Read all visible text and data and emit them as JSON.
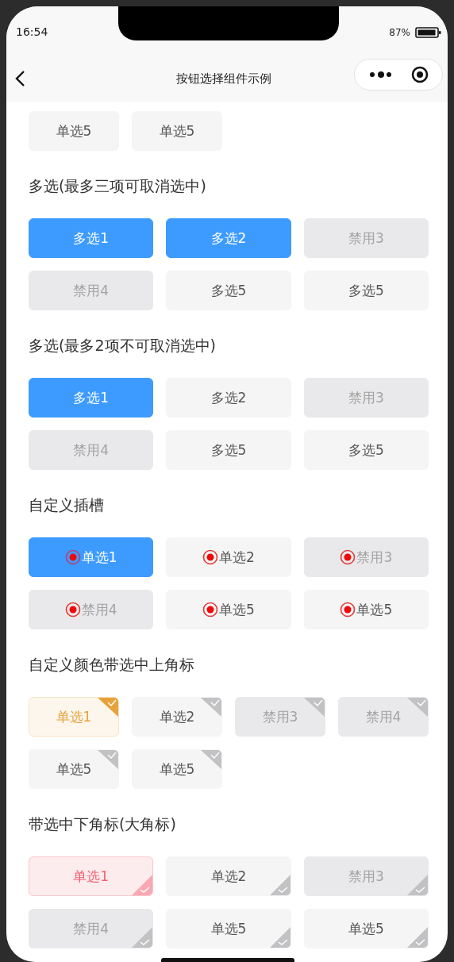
{
  "status_bar": {
    "time": "16:54",
    "battery": "87%"
  },
  "nav_bar": {
    "title": "按钮选择组件示例"
  },
  "sections": [
    {
      "kind": "compact",
      "options": [
        {
          "label": "单选5",
          "selected": false,
          "disabled": false
        },
        {
          "label": "单选5",
          "selected": false,
          "disabled": false
        }
      ]
    },
    {
      "kind": "plain",
      "title": "多选(最多三项可取消选中)",
      "options": [
        {
          "label": "多选1",
          "selected": true,
          "disabled": false
        },
        {
          "label": "多选2",
          "selected": true,
          "disabled": false
        },
        {
          "label": "禁用3",
          "selected": false,
          "disabled": true
        },
        {
          "label": "禁用4",
          "selected": false,
          "disabled": true
        },
        {
          "label": "多选5",
          "selected": false,
          "disabled": false
        },
        {
          "label": "多选5",
          "selected": false,
          "disabled": false
        }
      ]
    },
    {
      "kind": "plain",
      "title": "多选(最多2项不可取消选中)",
      "options": [
        {
          "label": "多选1",
          "selected": true,
          "disabled": false
        },
        {
          "label": "多选2",
          "selected": false,
          "disabled": false
        },
        {
          "label": "禁用3",
          "selected": false,
          "disabled": true
        },
        {
          "label": "禁用4",
          "selected": false,
          "disabled": true
        },
        {
          "label": "多选5",
          "selected": false,
          "disabled": false
        },
        {
          "label": "多选5",
          "selected": false,
          "disabled": false
        }
      ]
    },
    {
      "kind": "slot",
      "title": "自定义插槽",
      "options": [
        {
          "label": "单选1",
          "selected": true,
          "disabled": false
        },
        {
          "label": "单选2",
          "selected": false,
          "disabled": false
        },
        {
          "label": "禁用3",
          "selected": false,
          "disabled": true
        },
        {
          "label": "禁用4",
          "selected": false,
          "disabled": true
        },
        {
          "label": "单选5",
          "selected": false,
          "disabled": false
        },
        {
          "label": "单选5",
          "selected": false,
          "disabled": false
        }
      ]
    },
    {
      "kind": "corner-top",
      "title": "自定义颜色带选中上角标",
      "options": [
        {
          "label": "单选1",
          "selected": true,
          "disabled": false
        },
        {
          "label": "单选2",
          "selected": false,
          "disabled": false
        },
        {
          "label": "禁用3",
          "selected": false,
          "disabled": true
        },
        {
          "label": "禁用4",
          "selected": false,
          "disabled": true
        },
        {
          "label": "单选5",
          "selected": false,
          "disabled": false
        },
        {
          "label": "单选5",
          "selected": false,
          "disabled": false
        }
      ]
    },
    {
      "kind": "corner-bottom",
      "title": "带选中下角标(大角标)",
      "options": [
        {
          "label": "单选1",
          "selected": true,
          "disabled": false
        },
        {
          "label": "单选2",
          "selected": false,
          "disabled": false
        },
        {
          "label": "禁用3",
          "selected": false,
          "disabled": true
        },
        {
          "label": "禁用4",
          "selected": false,
          "disabled": true
        },
        {
          "label": "单选5",
          "selected": false,
          "disabled": false
        },
        {
          "label": "单选5",
          "selected": false,
          "disabled": false
        }
      ]
    }
  ]
}
